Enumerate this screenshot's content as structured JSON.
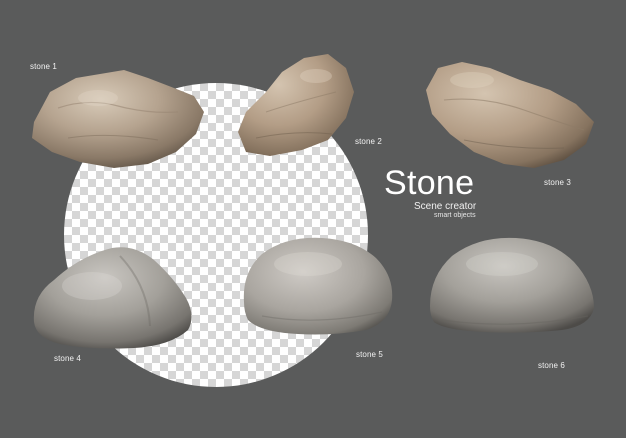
{
  "title": "Stone",
  "subtitle": "Scene creator",
  "tagline": "smart objects",
  "stones": [
    {
      "label": "stone 1"
    },
    {
      "label": "stone 2"
    },
    {
      "label": "stone 3"
    },
    {
      "label": "stone 4"
    },
    {
      "label": "stone 5"
    },
    {
      "label": "stone 6"
    }
  ],
  "colors": {
    "background": "#5a5b5b",
    "checker_light": "#ffffff",
    "checker_dark": "#d6d6d6",
    "rock_tan": "#b3a28f",
    "rock_grey": "#a29e98",
    "text": "#ffffff"
  }
}
